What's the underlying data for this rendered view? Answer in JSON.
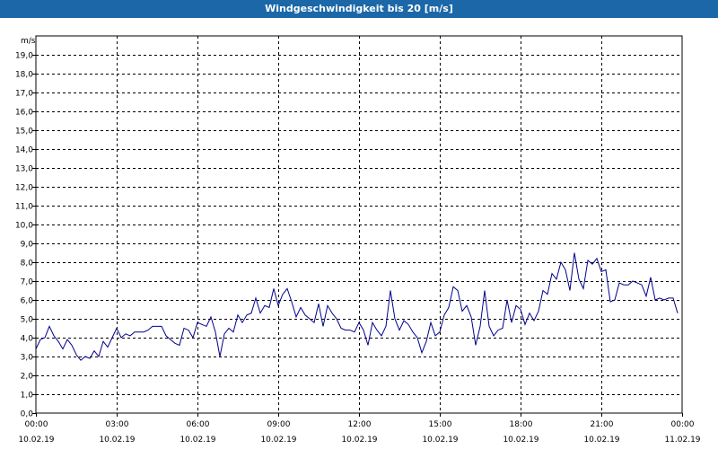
{
  "window": {
    "title": "Windgeschwindigkeit bis 20 [m/s]"
  },
  "chart_data": {
    "type": "line",
    "title": "Windgeschwindigkeit bis 20 [m/s]",
    "ylabel": "m/s",
    "ylim": [
      0,
      20
    ],
    "y_ticks": [
      "0,0",
      "1,0",
      "2,0",
      "3,0",
      "4,0",
      "5,0",
      "6,0",
      "7,0",
      "8,0",
      "9,0",
      "10,0",
      "11,0",
      "12,0",
      "13,0",
      "14,0",
      "15,0",
      "16,0",
      "17,0",
      "18,0",
      "19,0"
    ],
    "x_ticks": [
      {
        "time": "00:00",
        "date": "10.02.19"
      },
      {
        "time": "03:00",
        "date": "10.02.19"
      },
      {
        "time": "06:00",
        "date": "10.02.19"
      },
      {
        "time": "09:00",
        "date": "10.02.19"
      },
      {
        "time": "12:00",
        "date": "10.02.19"
      },
      {
        "time": "15:00",
        "date": "10.02.19"
      },
      {
        "time": "18:00",
        "date": "10.02.19"
      },
      {
        "time": "21:00",
        "date": "10.02.19"
      },
      {
        "time": "00:00",
        "date": "11.02.19"
      }
    ],
    "xlim": [
      "10.02.19 00:00",
      "11.02.19 00:00"
    ],
    "grid": true,
    "line_color": "#00008b",
    "series": [
      {
        "values": [
          [
            "10.02.19 00:00",
            3.4
          ],
          [
            "10.02.19 00:10",
            3.9
          ],
          [
            "10.02.19 00:20",
            4.0
          ],
          [
            "10.02.19 00:30",
            4.6
          ],
          [
            "10.02.19 00:40",
            4.1
          ],
          [
            "10.02.19 00:50",
            3.8
          ],
          [
            "10.02.19 01:00",
            3.4
          ],
          [
            "10.02.19 01:10",
            3.9
          ],
          [
            "10.02.19 01:20",
            3.6
          ],
          [
            "10.02.19 01:30",
            3.1
          ],
          [
            "10.02.19 01:40",
            2.8
          ],
          [
            "10.02.19 01:50",
            3.0
          ],
          [
            "10.02.19 02:00",
            2.9
          ],
          [
            "10.02.19 02:10",
            3.3
          ],
          [
            "10.02.19 02:20",
            3.0
          ],
          [
            "10.02.19 02:30",
            3.8
          ],
          [
            "10.02.19 02:40",
            3.5
          ],
          [
            "10.02.19 02:50",
            4.0
          ],
          [
            "10.02.19 03:00",
            4.5
          ],
          [
            "10.02.19 03:10",
            4.0
          ],
          [
            "10.02.19 03:20",
            4.2
          ],
          [
            "10.02.19 03:30",
            4.1
          ],
          [
            "10.02.19 03:40",
            4.3
          ],
          [
            "10.02.19 03:50",
            4.3
          ],
          [
            "10.02.19 04:00",
            4.3
          ],
          [
            "10.02.19 04:10",
            4.4
          ],
          [
            "10.02.19 04:20",
            4.6
          ],
          [
            "10.02.19 04:30",
            4.6
          ],
          [
            "10.02.19 04:40",
            4.6
          ],
          [
            "10.02.19 04:50",
            4.1
          ],
          [
            "10.02.19 05:00",
            3.9
          ],
          [
            "10.02.19 05:10",
            3.7
          ],
          [
            "10.02.19 05:20",
            3.6
          ],
          [
            "10.02.19 05:30",
            4.5
          ],
          [
            "10.02.19 05:40",
            4.4
          ],
          [
            "10.02.19 05:50",
            4.0
          ],
          [
            "10.02.19 06:00",
            4.8
          ],
          [
            "10.02.19 06:10",
            4.7
          ],
          [
            "10.02.19 06:20",
            4.6
          ],
          [
            "10.02.19 06:30",
            5.1
          ],
          [
            "10.02.19 06:40",
            4.3
          ],
          [
            "10.02.19 06:50",
            3.0
          ],
          [
            "10.02.19 07:00",
            4.2
          ],
          [
            "10.02.19 07:10",
            4.5
          ],
          [
            "10.02.19 07:20",
            4.3
          ],
          [
            "10.02.19 07:30",
            5.2
          ],
          [
            "10.02.19 07:40",
            4.8
          ],
          [
            "10.02.19 07:50",
            5.2
          ],
          [
            "10.02.19 08:00",
            5.3
          ],
          [
            "10.02.19 08:10",
            6.1
          ],
          [
            "10.02.19 08:20",
            5.3
          ],
          [
            "10.02.19 08:30",
            5.7
          ],
          [
            "10.02.19 08:40",
            5.6
          ],
          [
            "10.02.19 08:50",
            6.6
          ],
          [
            "10.02.19 09:00",
            5.7
          ],
          [
            "10.02.19 09:10",
            6.3
          ],
          [
            "10.02.19 09:20",
            6.6
          ],
          [
            "10.02.19 09:30",
            5.9
          ],
          [
            "10.02.19 09:40",
            5.1
          ],
          [
            "10.02.19 09:50",
            5.6
          ],
          [
            "10.02.19 10:00",
            5.2
          ],
          [
            "10.02.19 10:10",
            5.0
          ],
          [
            "10.02.19 10:20",
            4.8
          ],
          [
            "10.02.19 10:30",
            5.8
          ],
          [
            "10.02.19 10:40",
            4.6
          ],
          [
            "10.02.19 10:50",
            5.7
          ],
          [
            "10.02.19 11:00",
            5.3
          ],
          [
            "10.02.19 11:10",
            5.0
          ],
          [
            "10.02.19 11:20",
            4.5
          ],
          [
            "10.02.19 11:30",
            4.4
          ],
          [
            "10.02.19 11:40",
            4.4
          ],
          [
            "10.02.19 11:50",
            4.3
          ],
          [
            "10.02.19 12:00",
            4.8
          ],
          [
            "10.02.19 12:10",
            4.4
          ],
          [
            "10.02.19 12:20",
            3.6
          ],
          [
            "10.02.19 12:30",
            4.8
          ],
          [
            "10.02.19 12:40",
            4.4
          ],
          [
            "10.02.19 12:50",
            4.1
          ],
          [
            "10.02.19 13:00",
            4.6
          ],
          [
            "10.02.19 13:10",
            6.5
          ],
          [
            "10.02.19 13:20",
            5.0
          ],
          [
            "10.02.19 13:30",
            4.4
          ],
          [
            "10.02.19 13:40",
            4.9
          ],
          [
            "10.02.19 13:50",
            4.7
          ],
          [
            "10.02.19 14:00",
            4.3
          ],
          [
            "10.02.19 14:10",
            4.0
          ],
          [
            "10.02.19 14:20",
            3.2
          ],
          [
            "10.02.19 14:30",
            3.8
          ],
          [
            "10.02.19 14:40",
            4.8
          ],
          [
            "10.02.19 14:50",
            4.1
          ],
          [
            "10.02.19 15:00",
            4.3
          ],
          [
            "10.02.19 15:10",
            5.2
          ],
          [
            "10.02.19 15:20",
            5.6
          ],
          [
            "10.02.19 15:30",
            6.7
          ],
          [
            "10.02.19 15:40",
            6.5
          ],
          [
            "10.02.19 15:50",
            5.4
          ],
          [
            "10.02.19 16:00",
            5.7
          ],
          [
            "10.02.19 16:10",
            5.1
          ],
          [
            "10.02.19 16:20",
            3.6
          ],
          [
            "10.02.19 16:30",
            4.6
          ],
          [
            "10.02.19 16:40",
            6.5
          ],
          [
            "10.02.19 16:50",
            4.6
          ],
          [
            "10.02.19 17:00",
            4.1
          ],
          [
            "10.02.19 17:10",
            4.4
          ],
          [
            "10.02.19 17:20",
            4.5
          ],
          [
            "10.02.19 17:30",
            6.0
          ],
          [
            "10.02.19 17:40",
            4.8
          ],
          [
            "10.02.19 17:50",
            5.7
          ],
          [
            "10.02.19 18:00",
            5.5
          ],
          [
            "10.02.19 18:10",
            4.7
          ],
          [
            "10.02.19 18:20",
            5.3
          ],
          [
            "10.02.19 18:30",
            4.9
          ],
          [
            "10.02.19 18:40",
            5.4
          ],
          [
            "10.02.19 18:50",
            6.5
          ],
          [
            "10.02.19 19:00",
            6.3
          ],
          [
            "10.02.19 19:10",
            7.4
          ],
          [
            "10.02.19 19:20",
            7.1
          ],
          [
            "10.02.19 19:30",
            8.0
          ],
          [
            "10.02.19 19:40",
            7.6
          ],
          [
            "10.02.19 19:50",
            6.5
          ],
          [
            "10.02.19 20:00",
            8.5
          ],
          [
            "10.02.19 20:10",
            7.1
          ],
          [
            "10.02.19 20:20",
            6.6
          ],
          [
            "10.02.19 20:30",
            8.1
          ],
          [
            "10.02.19 20:40",
            7.9
          ],
          [
            "10.02.19 20:50",
            8.2
          ],
          [
            "10.02.19 21:00",
            7.5
          ],
          [
            "10.02.19 21:10",
            7.6
          ],
          [
            "10.02.19 21:20",
            5.9
          ],
          [
            "10.02.19 21:30",
            6.0
          ],
          [
            "10.02.19 21:40",
            6.9
          ],
          [
            "10.02.19 21:50",
            6.8
          ],
          [
            "10.02.19 22:00",
            6.8
          ],
          [
            "10.02.19 22:10",
            7.0
          ],
          [
            "10.02.19 22:20",
            6.9
          ],
          [
            "10.02.19 22:30",
            6.8
          ],
          [
            "10.02.19 22:40",
            6.2
          ],
          [
            "10.02.19 22:50",
            7.2
          ],
          [
            "10.02.19 23:00",
            6.0
          ],
          [
            "10.02.19 23:10",
            6.1
          ],
          [
            "10.02.19 23:20",
            6.0
          ],
          [
            "10.02.19 23:30",
            6.1
          ],
          [
            "10.02.19 23:40",
            6.1
          ],
          [
            "10.02.19 23:50",
            5.3
          ]
        ]
      }
    ]
  }
}
